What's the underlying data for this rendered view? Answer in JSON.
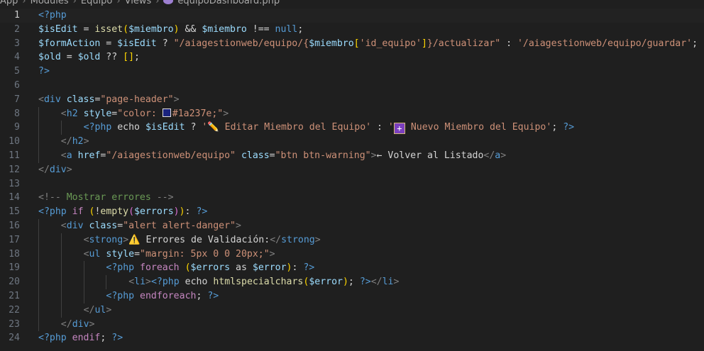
{
  "breadcrumb": {
    "items": [
      "App",
      "Modules",
      "Equipo",
      "Views"
    ],
    "file": "equipoDashboard.php",
    "icon": "php-file-icon"
  },
  "editor": {
    "active_line": 1,
    "lines": [
      {
        "n": "1",
        "indent": 0,
        "tokens": [
          [
            "t-tag",
            "<?php"
          ]
        ]
      },
      {
        "n": "2",
        "indent": 0,
        "tokens": [
          [
            "t-var",
            "$isEdit"
          ],
          [
            "t-text",
            " = "
          ],
          [
            "t-func",
            "isset"
          ],
          [
            "t-brace1",
            "("
          ],
          [
            "t-var",
            "$miembro"
          ],
          [
            "t-brace1",
            ")"
          ],
          [
            "t-text",
            " && "
          ],
          [
            "t-var",
            "$miembro"
          ],
          [
            "t-text",
            " !== "
          ],
          [
            "t-null",
            "null"
          ],
          [
            "t-text",
            ";"
          ]
        ]
      },
      {
        "n": "3",
        "indent": 0,
        "tokens": [
          [
            "t-var",
            "$formAction"
          ],
          [
            "t-text",
            " = "
          ],
          [
            "t-var",
            "$isEdit"
          ],
          [
            "t-text",
            " ? "
          ],
          [
            "t-str",
            "\"/aiagestionweb/equipo/{"
          ],
          [
            "t-var",
            "$miembro"
          ],
          [
            "t-brace1",
            "["
          ],
          [
            "t-str",
            "'id_equipo'"
          ],
          [
            "t-brace1",
            "]"
          ],
          [
            "t-str",
            "}/actualizar\""
          ],
          [
            "t-text",
            " : "
          ],
          [
            "t-str",
            "'/aiagestionweb/equipo/guardar'"
          ],
          [
            "t-text",
            ";"
          ]
        ]
      },
      {
        "n": "4",
        "indent": 0,
        "tokens": [
          [
            "t-var",
            "$old"
          ],
          [
            "t-text",
            " = "
          ],
          [
            "t-var",
            "$old"
          ],
          [
            "t-text",
            " ?? "
          ],
          [
            "t-brace1",
            "[]"
          ],
          [
            "t-text",
            ";"
          ]
        ]
      },
      {
        "n": "5",
        "indent": 0,
        "tokens": [
          [
            "t-tag",
            "?>"
          ]
        ]
      },
      {
        "n": "6",
        "indent": 0,
        "tokens": []
      },
      {
        "n": "7",
        "indent": 0,
        "tokens": [
          [
            "t-punc",
            "<"
          ],
          [
            "t-tag",
            "div"
          ],
          [
            "t-text",
            " "
          ],
          [
            "t-attr",
            "class"
          ],
          [
            "t-text",
            "="
          ],
          [
            "t-str",
            "\"page-header\""
          ],
          [
            "t-punc",
            ">"
          ]
        ]
      },
      {
        "n": "8",
        "indent": 1,
        "tokens": [
          [
            "t-punc",
            "<"
          ],
          [
            "t-tag",
            "h2"
          ],
          [
            "t-text",
            " "
          ],
          [
            "t-attr",
            "style"
          ],
          [
            "t-text",
            "="
          ],
          [
            "t-str",
            "\"color: "
          ],
          [
            "swatch",
            ""
          ],
          [
            "t-str",
            "#1a237e;\""
          ],
          [
            "t-punc",
            ">"
          ]
        ]
      },
      {
        "n": "9",
        "indent": 2,
        "tokens": [
          [
            "t-php",
            "<?php"
          ],
          [
            "t-text",
            " echo "
          ],
          [
            "t-var",
            "$isEdit"
          ],
          [
            "t-text",
            " ? "
          ],
          [
            "t-str",
            "'"
          ],
          [
            "emoji-pencil",
            "✏️"
          ],
          [
            "t-str",
            " Editar Miembro del Equipo'"
          ],
          [
            "t-text",
            " : "
          ],
          [
            "t-str",
            "'"
          ],
          [
            "emoji-plus",
            "+"
          ],
          [
            "t-str",
            " Nuevo Miembro del Equipo'"
          ],
          [
            "t-text",
            "; "
          ],
          [
            "t-php",
            "?>"
          ]
        ]
      },
      {
        "n": "10",
        "indent": 1,
        "tokens": [
          [
            "t-punc",
            "</"
          ],
          [
            "t-tag",
            "h2"
          ],
          [
            "t-punc",
            ">"
          ]
        ]
      },
      {
        "n": "11",
        "indent": 1,
        "tokens": [
          [
            "t-punc",
            "<"
          ],
          [
            "t-tag",
            "a"
          ],
          [
            "t-text",
            " "
          ],
          [
            "t-attr",
            "href"
          ],
          [
            "t-text",
            "="
          ],
          [
            "t-str",
            "\"/aiagestionweb/equipo\""
          ],
          [
            "t-text",
            " "
          ],
          [
            "t-attr",
            "class"
          ],
          [
            "t-text",
            "="
          ],
          [
            "t-str",
            "\"btn btn-warning\""
          ],
          [
            "t-punc",
            ">"
          ],
          [
            "t-text",
            "← Volver al Listado"
          ],
          [
            "t-punc",
            "</"
          ],
          [
            "t-tag",
            "a"
          ],
          [
            "t-punc",
            ">"
          ]
        ]
      },
      {
        "n": "12",
        "indent": 0,
        "tokens": [
          [
            "t-punc",
            "</"
          ],
          [
            "t-tag",
            "div"
          ],
          [
            "t-punc",
            ">"
          ]
        ]
      },
      {
        "n": "13",
        "indent": 0,
        "tokens": []
      },
      {
        "n": "14",
        "indent": 0,
        "tokens": [
          [
            "t-punc",
            "<!-- "
          ],
          [
            "t-comment",
            "Mostrar errores"
          ],
          [
            "t-punc",
            " -->"
          ]
        ]
      },
      {
        "n": "15",
        "indent": 0,
        "tokens": [
          [
            "t-php",
            "<?php"
          ],
          [
            "t-text",
            " "
          ],
          [
            "t-kw",
            "if"
          ],
          [
            "t-text",
            " "
          ],
          [
            "t-brace1",
            "("
          ],
          [
            "t-text",
            "!"
          ],
          [
            "t-func",
            "empty"
          ],
          [
            "t-brace2",
            "("
          ],
          [
            "t-var",
            "$errors"
          ],
          [
            "t-brace2",
            ")"
          ],
          [
            "t-brace1",
            ")"
          ],
          [
            "t-text",
            ": "
          ],
          [
            "t-php",
            "?>"
          ]
        ]
      },
      {
        "n": "16",
        "indent": 1,
        "tokens": [
          [
            "t-punc",
            "<"
          ],
          [
            "t-tag",
            "div"
          ],
          [
            "t-text",
            " "
          ],
          [
            "t-attr",
            "class"
          ],
          [
            "t-text",
            "="
          ],
          [
            "t-str",
            "\"alert alert-danger\""
          ],
          [
            "t-punc",
            ">"
          ]
        ]
      },
      {
        "n": "17",
        "indent": 2,
        "tokens": [
          [
            "t-punc",
            "<"
          ],
          [
            "t-tag",
            "strong"
          ],
          [
            "t-punc",
            ">"
          ],
          [
            "emoji-warn",
            "⚠️"
          ],
          [
            "t-text",
            " Errores de Validación:"
          ],
          [
            "t-punc",
            "</"
          ],
          [
            "t-tag",
            "strong"
          ],
          [
            "t-punc",
            ">"
          ]
        ]
      },
      {
        "n": "18",
        "indent": 2,
        "tokens": [
          [
            "t-punc",
            "<"
          ],
          [
            "t-tag",
            "ul"
          ],
          [
            "t-text",
            " "
          ],
          [
            "t-attr",
            "style"
          ],
          [
            "t-text",
            "="
          ],
          [
            "t-str",
            "\"margin: 5px 0 0 20px;\""
          ],
          [
            "t-punc",
            ">"
          ]
        ]
      },
      {
        "n": "19",
        "indent": 3,
        "tokens": [
          [
            "t-php",
            "<?php"
          ],
          [
            "t-text",
            " "
          ],
          [
            "t-kw",
            "foreach"
          ],
          [
            "t-text",
            " "
          ],
          [
            "t-brace1",
            "("
          ],
          [
            "t-var",
            "$errors"
          ],
          [
            "t-text",
            " as "
          ],
          [
            "t-var",
            "$error"
          ],
          [
            "t-brace1",
            ")"
          ],
          [
            "t-text",
            ": "
          ],
          [
            "t-php",
            "?>"
          ]
        ]
      },
      {
        "n": "20",
        "indent": 4,
        "tokens": [
          [
            "t-punc",
            "<"
          ],
          [
            "t-tag",
            "li"
          ],
          [
            "t-punc",
            ">"
          ],
          [
            "t-php",
            "<?php"
          ],
          [
            "t-text",
            " echo "
          ],
          [
            "t-func",
            "htmlspecialchars"
          ],
          [
            "t-brace1",
            "("
          ],
          [
            "t-var",
            "$error"
          ],
          [
            "t-brace1",
            ")"
          ],
          [
            "t-text",
            "; "
          ],
          [
            "t-php",
            "?>"
          ],
          [
            "t-punc",
            "</"
          ],
          [
            "t-tag",
            "li"
          ],
          [
            "t-punc",
            ">"
          ]
        ]
      },
      {
        "n": "21",
        "indent": 3,
        "tokens": [
          [
            "t-php",
            "<?php"
          ],
          [
            "t-text",
            " "
          ],
          [
            "t-kw",
            "endforeach"
          ],
          [
            "t-text",
            "; "
          ],
          [
            "t-php",
            "?>"
          ]
        ]
      },
      {
        "n": "22",
        "indent": 2,
        "tokens": [
          [
            "t-punc",
            "</"
          ],
          [
            "t-tag",
            "ul"
          ],
          [
            "t-punc",
            ">"
          ]
        ]
      },
      {
        "n": "23",
        "indent": 1,
        "tokens": [
          [
            "t-punc",
            "</"
          ],
          [
            "t-tag",
            "div"
          ],
          [
            "t-punc",
            ">"
          ]
        ]
      },
      {
        "n": "24",
        "indent": 0,
        "tokens": [
          [
            "t-php",
            "<?php"
          ],
          [
            "t-text",
            " "
          ],
          [
            "t-kw",
            "endif"
          ],
          [
            "t-text",
            "; "
          ],
          [
            "t-php",
            "?>"
          ]
        ]
      }
    ]
  }
}
